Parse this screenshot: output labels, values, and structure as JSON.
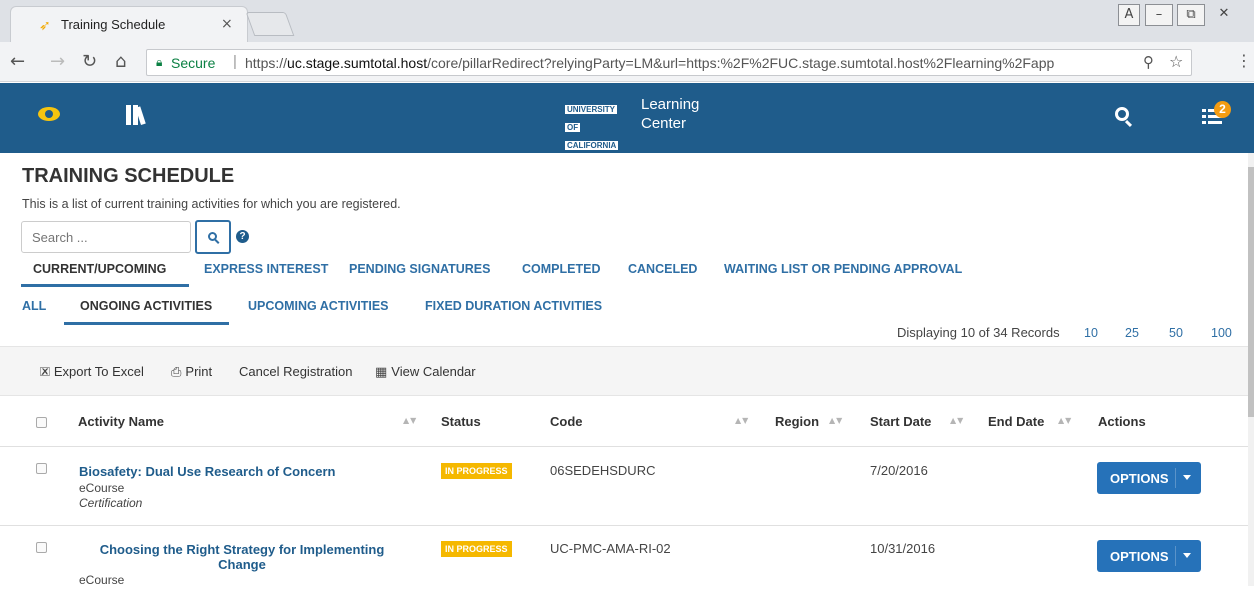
{
  "browser": {
    "tab_title": "Training Schedule",
    "tab_close": "×",
    "secure_label": "Secure",
    "url_scheme": "https://",
    "url_host": "uc.stage.sumtotal.host",
    "url_path": "/core/pillarRedirect?relyingParty=LM&url=https:%2F%2FUC.stage.sumtotal.host%2Flearning%2Fapp"
  },
  "app": {
    "logo_lines": [
      "UNIVERSITY",
      "OF",
      "CALIFORNIA"
    ],
    "title_line1": "Learning",
    "title_line2": "Center",
    "notification_count": "2"
  },
  "page": {
    "title": "TRAINING SCHEDULE",
    "description": "This is a list of current training activities for which you are registered.",
    "search_placeholder": "Search ..."
  },
  "tabs_primary": [
    {
      "label": "CURRENT/UPCOMING",
      "active": true
    },
    {
      "label": "EXPRESS INTEREST",
      "active": false
    },
    {
      "label": "PENDING SIGNATURES",
      "active": false
    },
    {
      "label": "COMPLETED",
      "active": false
    },
    {
      "label": "CANCELED",
      "active": false
    },
    {
      "label": "WAITING LIST OR PENDING APPROVAL",
      "active": false
    }
  ],
  "tabs_secondary": [
    {
      "label": "ALL",
      "active": false
    },
    {
      "label": "ONGOING ACTIVITIES",
      "active": true
    },
    {
      "label": "UPCOMING ACTIVITIES",
      "active": false
    },
    {
      "label": "FIXED DURATION ACTIVITIES",
      "active": false
    }
  ],
  "records_text": "Displaying 10 of 34 Records",
  "page_sizes": [
    "10",
    "25",
    "50",
    "100"
  ],
  "toolbar": {
    "export": "Export To Excel",
    "print": "Print",
    "cancel": "Cancel Registration",
    "calendar": "View Calendar"
  },
  "table": {
    "columns": {
      "activity_name": "Activity Name",
      "status": "Status",
      "code": "Code",
      "region": "Region",
      "start_date": "Start Date",
      "end_date": "End Date",
      "actions": "Actions"
    },
    "rows": [
      {
        "name": "Biosafety: Dual Use Research of Concern",
        "type": "eCourse",
        "category": "Certification",
        "status": "IN PROGRESS",
        "code": "06SEDEHSDURC",
        "region": "",
        "start_date": "7/20/2016",
        "end_date": "",
        "action": "OPTIONS"
      },
      {
        "name_line1": "Choosing the Right Strategy for Implementing",
        "name_line2": "Change",
        "type": "eCourse",
        "status": "IN PROGRESS",
        "code": "UC-PMC-AMA-RI-02",
        "region": "",
        "start_date": "10/31/2016",
        "end_date": "",
        "action": "OPTIONS"
      }
    ]
  },
  "colors": {
    "header_bg": "#1f5c8b",
    "link": "#2f6fa5",
    "status_in_progress": "#f5b800",
    "options_button": "#2672b9",
    "badge": "#f39c12"
  }
}
